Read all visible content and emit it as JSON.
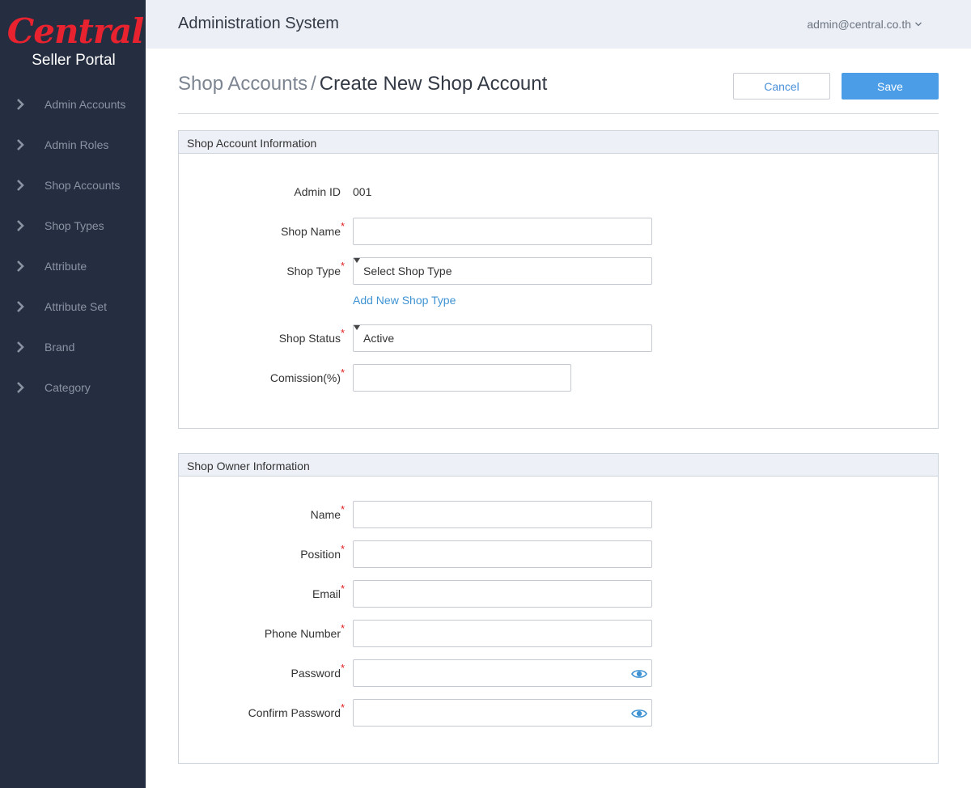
{
  "brand": {
    "logo_text": "Central",
    "subtitle": "Seller Portal",
    "accent": "#e8232f"
  },
  "sidebar": {
    "items": [
      {
        "label": "Admin Accounts",
        "icon": "chevron-right-icon"
      },
      {
        "label": "Admin Roles",
        "icon": "chevron-right-icon"
      },
      {
        "label": "Shop Accounts",
        "icon": "chevron-right-icon"
      },
      {
        "label": "Shop Types",
        "icon": "chevron-right-icon"
      },
      {
        "label": "Attribute",
        "icon": "chevron-right-icon"
      },
      {
        "label": "Attribute Set",
        "icon": "chevron-right-icon"
      },
      {
        "label": "Brand",
        "icon": "chevron-right-icon"
      },
      {
        "label": "Category",
        "icon": "chevron-right-icon"
      }
    ]
  },
  "header": {
    "title": "Administration System",
    "user": "admin@central.co.th"
  },
  "page": {
    "breadcrumb_parent": "Shop Accounts",
    "breadcrumb_sep": "/",
    "breadcrumb_current": "Create New Shop Account",
    "cancel_label": "Cancel",
    "save_label": "Save",
    "primary_color": "#4a9de6"
  },
  "shop_info": {
    "title": "Shop Account Information",
    "admin_id_label": "Admin ID",
    "admin_id_value": "001",
    "shop_name_label": "Shop Name",
    "shop_name_value": "",
    "shop_type_label": "Shop Type",
    "shop_type_value": "Select Shop Type",
    "add_shop_type_link": "Add New Shop Type",
    "shop_status_label": "Shop Status",
    "shop_status_value": "Active",
    "commission_label": "Comission(%)",
    "commission_value": "",
    "required_mark": "*"
  },
  "owner_info": {
    "title": "Shop Owner Information",
    "name_label": "Name",
    "position_label": "Position",
    "email_label": "Email",
    "phone_label": "Phone Number",
    "password_label": "Password",
    "confirm_password_label": "Confirm Password",
    "required_mark": "*"
  }
}
